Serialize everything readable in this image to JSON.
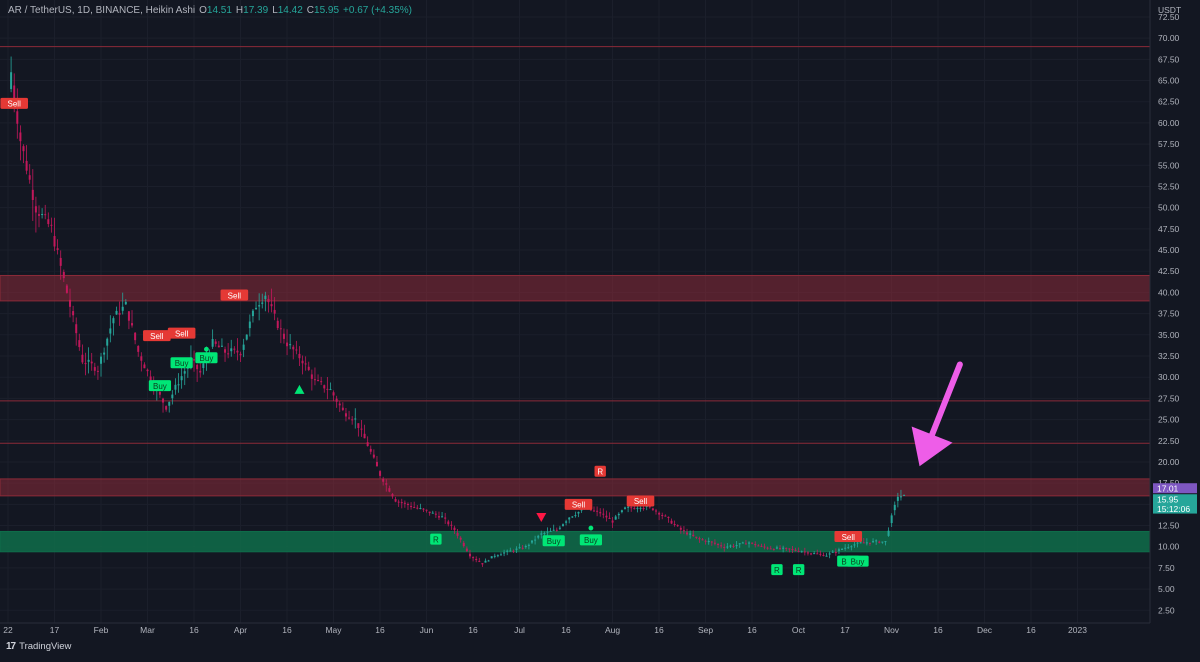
{
  "header": {
    "symbol": "AR / TetherUS, 1D, BINANCE, Heikin Ashi",
    "o_label": "O",
    "o_value": "14.51",
    "h_label": "H",
    "h_value": "17.39",
    "l_label": "L",
    "l_value": "14.42",
    "c_label": "C",
    "c_value": "15.95",
    "change": "+0.67 (+4.35%)"
  },
  "axis": {
    "currency": "USDT",
    "price_ticks": [
      "72.50",
      "70.00",
      "67.50",
      "65.00",
      "62.50",
      "60.00",
      "57.50",
      "55.00",
      "52.50",
      "50.00",
      "47.50",
      "45.00",
      "42.50",
      "40.00",
      "37.50",
      "35.00",
      "32.50",
      "30.00",
      "27.50",
      "25.00",
      "22.50",
      "20.00",
      "17.50",
      "15.00",
      "12.50",
      "10.00",
      "7.50",
      "5.00",
      "2.50"
    ],
    "time_ticks": [
      "22",
      "17",
      "Feb",
      "Mar",
      "16",
      "Apr",
      "16",
      "May",
      "16",
      "Jun",
      "16",
      "Jul",
      "16",
      "Aug",
      "16",
      "Sep",
      "16",
      "Oct",
      "17",
      "Nov",
      "16",
      "Dec",
      "16",
      "2023"
    ]
  },
  "price_tags": [
    {
      "text": "17.01",
      "color": "#7e57c2"
    },
    {
      "text": "15.95",
      "color": "#26a69a"
    },
    {
      "text": "15:12:06",
      "color": "#26a69a"
    }
  ],
  "brand": {
    "name": "TradingView",
    "mark": "17"
  },
  "colors": {
    "up": "#26a69a",
    "up_bright": "#00e676",
    "down": "#c2185b",
    "zone_red": "#8b2a38",
    "zone_green": "#0f6d4a",
    "arrow": "#ee5de8"
  },
  "chart_data": {
    "type": "candlestick",
    "chart_style": "heikin-ashi",
    "timeframe": "1D",
    "y_range": [
      1.0,
      74.5
    ],
    "x_range": [
      "2022-01-22",
      "2023-01-15"
    ],
    "horizontal_levels": [
      69.0,
      27.2,
      22.2
    ],
    "zones": [
      {
        "color": "red",
        "low": 39.0,
        "high": 42.0
      },
      {
        "color": "red",
        "low": 16.0,
        "high": 18.0
      },
      {
        "color": "green",
        "low": 9.4,
        "high": 11.8
      }
    ],
    "candle_path": [
      [
        "2022-01-22",
        62.0
      ],
      [
        "2022-01-23",
        66.0
      ],
      [
        "2022-01-26",
        58.0
      ],
      [
        "2022-01-31",
        50.0
      ],
      [
        "2022-02-05",
        47.5
      ],
      [
        "2022-02-10",
        40.0
      ],
      [
        "2022-02-15",
        32.0
      ],
      [
        "2022-02-20",
        31.0
      ],
      [
        "2022-02-25",
        37.0
      ],
      [
        "2022-03-01",
        38.5
      ],
      [
        "2022-03-05",
        33.0
      ],
      [
        "2022-03-10",
        29.0
      ],
      [
        "2022-03-14",
        26.5
      ],
      [
        "2022-03-18",
        29.5
      ],
      [
        "2022-03-22",
        32.0
      ],
      [
        "2022-03-25",
        30.5
      ],
      [
        "2022-03-29",
        34.0
      ],
      [
        "2022-04-02",
        33.0
      ],
      [
        "2022-04-07",
        33.0
      ],
      [
        "2022-04-12",
        38.5
      ],
      [
        "2022-04-15",
        39.8
      ],
      [
        "2022-04-18",
        37.0
      ],
      [
        "2022-04-22",
        34.0
      ],
      [
        "2022-04-27",
        32.0
      ],
      [
        "2022-05-01",
        29.5
      ],
      [
        "2022-05-06",
        28.5
      ],
      [
        "2022-05-10",
        26.0
      ],
      [
        "2022-05-14",
        25.0
      ],
      [
        "2022-05-18",
        22.0
      ],
      [
        "2022-05-22",
        18.5
      ],
      [
        "2022-05-27",
        15.5
      ],
      [
        "2022-06-01",
        14.8
      ],
      [
        "2022-06-06",
        14.2
      ],
      [
        "2022-06-11",
        13.5
      ],
      [
        "2022-06-15",
        12.0
      ],
      [
        "2022-06-20",
        9.0
      ],
      [
        "2022-06-24",
        8.0
      ],
      [
        "2022-06-28",
        9.0
      ],
      [
        "2022-07-03",
        9.5
      ],
      [
        "2022-07-08",
        10.0
      ],
      [
        "2022-07-13",
        11.5
      ],
      [
        "2022-07-18",
        12.0
      ],
      [
        "2022-07-22",
        13.5
      ],
      [
        "2022-07-27",
        14.5
      ],
      [
        "2022-08-01",
        14.0
      ],
      [
        "2022-08-05",
        13.0
      ],
      [
        "2022-08-09",
        14.5
      ],
      [
        "2022-08-14",
        14.8
      ],
      [
        "2022-08-18",
        14.5
      ],
      [
        "2022-08-22",
        13.5
      ],
      [
        "2022-08-27",
        12.0
      ],
      [
        "2022-09-01",
        11.0
      ],
      [
        "2022-09-06",
        10.5
      ],
      [
        "2022-09-10",
        10.0
      ],
      [
        "2022-09-14",
        10.2
      ],
      [
        "2022-09-18",
        10.5
      ],
      [
        "2022-09-22",
        10.0
      ],
      [
        "2022-09-26",
        9.8
      ],
      [
        "2022-10-01",
        9.7
      ],
      [
        "2022-10-05",
        9.5
      ],
      [
        "2022-10-09",
        9.2
      ],
      [
        "2022-10-13",
        9.0
      ],
      [
        "2022-10-17",
        9.6
      ],
      [
        "2022-10-21",
        10.2
      ],
      [
        "2022-10-25",
        10.5
      ],
      [
        "2022-10-29",
        10.6
      ],
      [
        "2022-11-01",
        10.6
      ],
      [
        "2022-11-03",
        13.5
      ],
      [
        "2022-11-05",
        16.0
      ],
      [
        "2022-11-07",
        15.95
      ]
    ],
    "signals": [
      {
        "text": "Sell",
        "date": "2022-01-24",
        "price": 62.3,
        "type": "sell"
      },
      {
        "text": "Sell",
        "date": "2022-03-11",
        "price": 34.9,
        "type": "sell"
      },
      {
        "text": "Sell",
        "date": "2022-03-19",
        "price": 35.2,
        "type": "sell"
      },
      {
        "text": "Sell",
        "date": "2022-04-05",
        "price": 39.7,
        "type": "sell"
      },
      {
        "text": "Sell",
        "date": "2022-07-25",
        "price": 15.0,
        "type": "sell"
      },
      {
        "text": "Sell",
        "date": "2022-08-14",
        "price": 15.4,
        "type": "sell"
      },
      {
        "text": "Sell",
        "date": "2022-10-20",
        "price": 11.2,
        "type": "sell"
      },
      {
        "text": "Buy",
        "date": "2022-03-12",
        "price": 29.0,
        "type": "buy"
      },
      {
        "text": "Buy",
        "date": "2022-03-19",
        "price": 31.7,
        "type": "buy"
      },
      {
        "text": "Buy",
        "date": "2022-03-27",
        "price": 32.3,
        "type": "buy"
      },
      {
        "text": "Buy",
        "date": "2022-07-17",
        "price": 10.7,
        "type": "buy"
      },
      {
        "text": "Buy",
        "date": "2022-07-29",
        "price": 10.8,
        "type": "buy"
      },
      {
        "text": "Buy",
        "date": "2022-10-20",
        "price": 8.3,
        "type": "buy"
      },
      {
        "text": "Buy",
        "date": "2022-10-23",
        "price": 8.3,
        "type": "buy"
      },
      {
        "text": "R",
        "date": "2022-06-09",
        "price": 10.9,
        "type": "buy"
      },
      {
        "text": "R",
        "date": "2022-08-01",
        "price": 18.9,
        "type": "sell"
      },
      {
        "text": "R",
        "date": "2022-09-27",
        "price": 7.3,
        "type": "buy"
      },
      {
        "text": "R",
        "date": "2022-10-04",
        "price": 7.3,
        "type": "buy"
      }
    ],
    "triangles": [
      {
        "date": "2022-04-26",
        "price": 28.5,
        "dir": "up",
        "color": "#00e676"
      },
      {
        "date": "2022-07-13",
        "price": 13.5,
        "dir": "down",
        "color": "#ff1744"
      }
    ],
    "dots": [
      {
        "date": "2022-03-27",
        "price": 33.3,
        "color": "#00e676"
      },
      {
        "date": "2022-07-29",
        "price": 12.2,
        "color": "#00e676"
      }
    ],
    "annotation_arrow": {
      "from": [
        "2022-11-25",
        31.5
      ],
      "to": [
        "2022-11-12",
        19.5
      ],
      "color": "magenta"
    }
  }
}
